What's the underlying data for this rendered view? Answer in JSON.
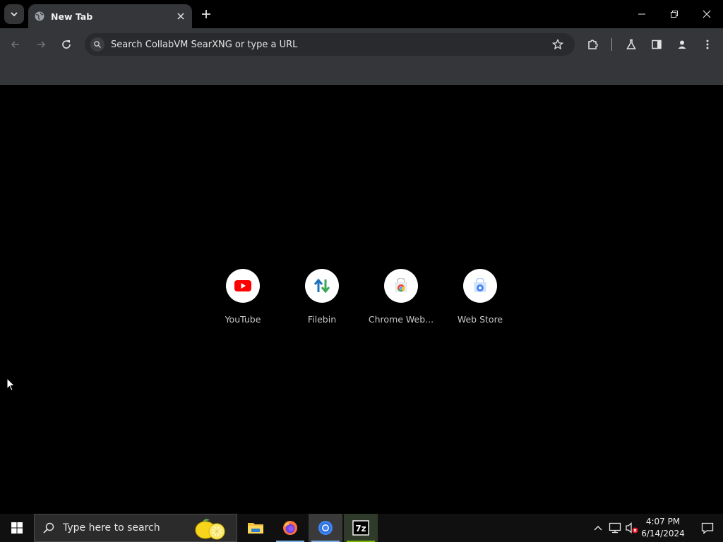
{
  "browser": {
    "tab": {
      "title": "New Tab"
    },
    "omnibox": {
      "placeholder": "Search CollabVM SearXNG or type a URL"
    }
  },
  "shortcuts": [
    {
      "label": "YouTube",
      "icon": "youtube-icon"
    },
    {
      "label": "Filebin",
      "icon": "filebin-icon"
    },
    {
      "label": "Chrome Web...",
      "icon": "chrome-web-store-icon"
    },
    {
      "label": "Web Store",
      "icon": "web-store-icon"
    }
  ],
  "taskbar": {
    "search_placeholder": "Type here to search",
    "apps": [
      "file-explorer-icon",
      "firefox-icon",
      "chrome-icon",
      "7zip-icon"
    ],
    "clock": {
      "time": "4:07 PM",
      "date": "6/14/2024"
    },
    "sevenzip_label": "7z"
  },
  "colors": {
    "chrome_frame": "#35363a",
    "omnibox_bg": "#282a2d",
    "taskbar_bg": "#101010",
    "youtube_red": "#ff0000"
  }
}
